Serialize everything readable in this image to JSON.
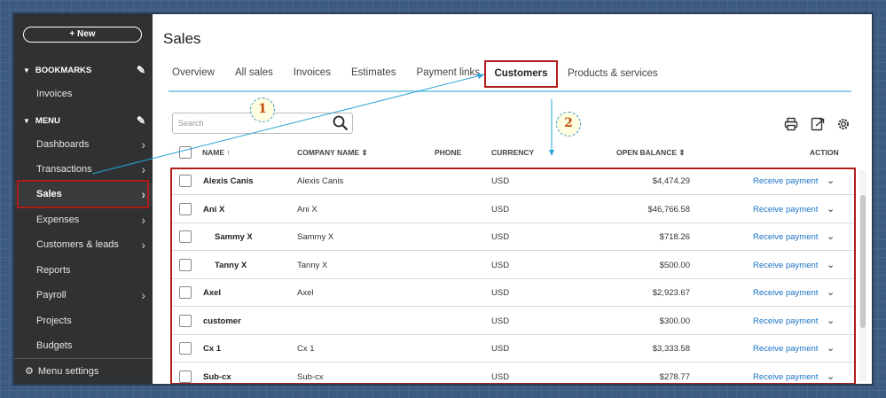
{
  "sidebar": {
    "new_label": "+ New",
    "bookmarks_label": "BOOKMARKS",
    "menu_label": "MENU",
    "items": [
      {
        "label": "Invoices"
      },
      {
        "label": "Dashboards"
      },
      {
        "label": "Transactions"
      },
      {
        "label": "Sales"
      },
      {
        "label": "Expenses"
      },
      {
        "label": "Customers & leads"
      },
      {
        "label": "Reports"
      },
      {
        "label": "Payroll"
      },
      {
        "label": "Projects"
      },
      {
        "label": "Budgets"
      }
    ],
    "settings_label": "Menu settings"
  },
  "header": {
    "title": "Sales"
  },
  "tabs": [
    "Overview",
    "All sales",
    "Invoices",
    "Estimates",
    "Payment links",
    "Customers",
    "Products & services"
  ],
  "search": {
    "placeholder": "Search"
  },
  "table": {
    "columns": [
      "NAME",
      "COMPANY NAME",
      "PHONE",
      "CURRENCY",
      "OPEN BALANCE",
      "ACTION"
    ],
    "rows": [
      {
        "name": "Alexis Canis",
        "company": "Alexis Canis",
        "currency": "USD",
        "balance": "$4,474.29",
        "action": "Receive payment"
      },
      {
        "name": "Ani X",
        "company": "Ani X",
        "currency": "USD",
        "balance": "$46,766.58",
        "action": "Receive payment"
      },
      {
        "name": "Sammy X",
        "company": "Sammy X",
        "currency": "USD",
        "balance": "$718.26",
        "action": "Receive payment"
      },
      {
        "name": "Tanny X",
        "company": "Tanny X",
        "currency": "USD",
        "balance": "$500.00",
        "action": "Receive payment"
      },
      {
        "name": "Axel",
        "company": "Axel",
        "currency": "USD",
        "balance": "$2,923.67",
        "action": "Receive payment"
      },
      {
        "name": "customer",
        "company": "",
        "currency": "USD",
        "balance": "$300.00",
        "action": "Receive payment"
      },
      {
        "name": "Cx 1",
        "company": "Cx 1",
        "currency": "USD",
        "balance": "$3,333.58",
        "action": "Receive payment"
      },
      {
        "name": "Sub-cx",
        "company": "Sub-cx",
        "currency": "USD",
        "balance": "$278.77",
        "action": "Receive payment"
      }
    ]
  },
  "annotations": {
    "step1": "1",
    "step2": "2"
  },
  "colors": {
    "sidebar_bg": "#2f3132",
    "highlight_red": "#b01c1c",
    "link_blue": "#1a73c7",
    "tab_underline": "#8fd0e8"
  }
}
